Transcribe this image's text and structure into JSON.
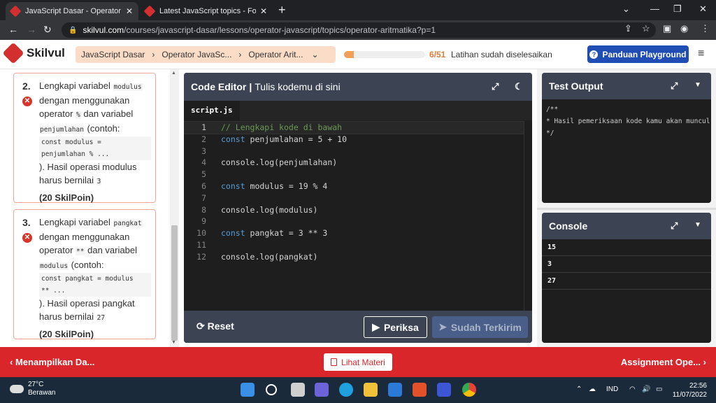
{
  "browser": {
    "tabs": [
      {
        "title": "JavaScript Dasar - Operator Javas",
        "active": true
      },
      {
        "title": "Latest JavaScript topics - Forum",
        "active": false
      }
    ],
    "url_host": "skilvul.com",
    "url_path": "/courses/javascript-dasar/lessons/operator-javascript/topics/operator-aritmatika?p=1"
  },
  "header": {
    "brand": "Skilvul",
    "breadcrumbs": [
      "JavaScript Dasar",
      "Operator JavaSc...",
      "Operator Arit..."
    ],
    "progress_count": "6/51",
    "progress_fraction": 0.118,
    "progress_text": "Latihan sudah diselesaikan",
    "guide_button": "Panduan Playground"
  },
  "tasks": [
    {
      "number": "2.",
      "text1": "Lengkapi variabel",
      "code1": "modulus",
      "text2": "dengan menggunakan operator",
      "code2": "%",
      "text3": "dan variabel",
      "code3": "penjumlahan",
      "text4": "(contoh:",
      "block": "const modulus =\npenjumlahan % ...",
      "text5": "). Hasil operasi modulus harus bernilai",
      "code4": "3",
      "points": "(20 SkilPoin)"
    },
    {
      "number": "3.",
      "text1": "Lengkapi variabel",
      "code1": "pangkat",
      "text2": "dengan menggunakan operator",
      "code2": "**",
      "text3": "dan variabel",
      "code3": "modulus",
      "text4": "(contoh:",
      "block": "const pangkat = modulus\n** ...",
      "text5": "). Hasil operasi pangkat harus bernilai",
      "code4": "27",
      "points": "(20 SkilPoin)"
    }
  ],
  "editor": {
    "title": "Code Editor",
    "subtitle": "Tulis kodemu di sini",
    "file": "script.js",
    "lines": [
      "// Lengkapi kode di bawah",
      "const penjumlahan = 5 + 10",
      "",
      "console.log(penjumlahan)",
      "",
      "const modulus = 19 % 4",
      "",
      "console.log(modulus)",
      "",
      "const pangkat = 3 ** 3",
      "",
      "console.log(pangkat)"
    ],
    "line_numbers": [
      "1",
      "2",
      "3",
      "4",
      "5",
      "6",
      "7",
      "8",
      "9",
      "10",
      "11",
      "12"
    ],
    "reset_label": "Reset",
    "check_label": "Periksa",
    "done_label": "Sudah Terkirim"
  },
  "test_output": {
    "title": "Test Output",
    "text": "/**\n* Hasil pemeriksaan kode kamu akan muncul di sini\n*/"
  },
  "console": {
    "title": "Console",
    "lines": [
      "15",
      "3",
      "27"
    ]
  },
  "bottom": {
    "prev_label": "Menampilkan Da...",
    "center_label": "Lihat Materi",
    "next_label": "Assignment Ope..."
  },
  "taskbar": {
    "temp": "27°C",
    "weather": "Berawan",
    "lang": "IND",
    "time": "22:56",
    "date": "11/07/2022"
  }
}
